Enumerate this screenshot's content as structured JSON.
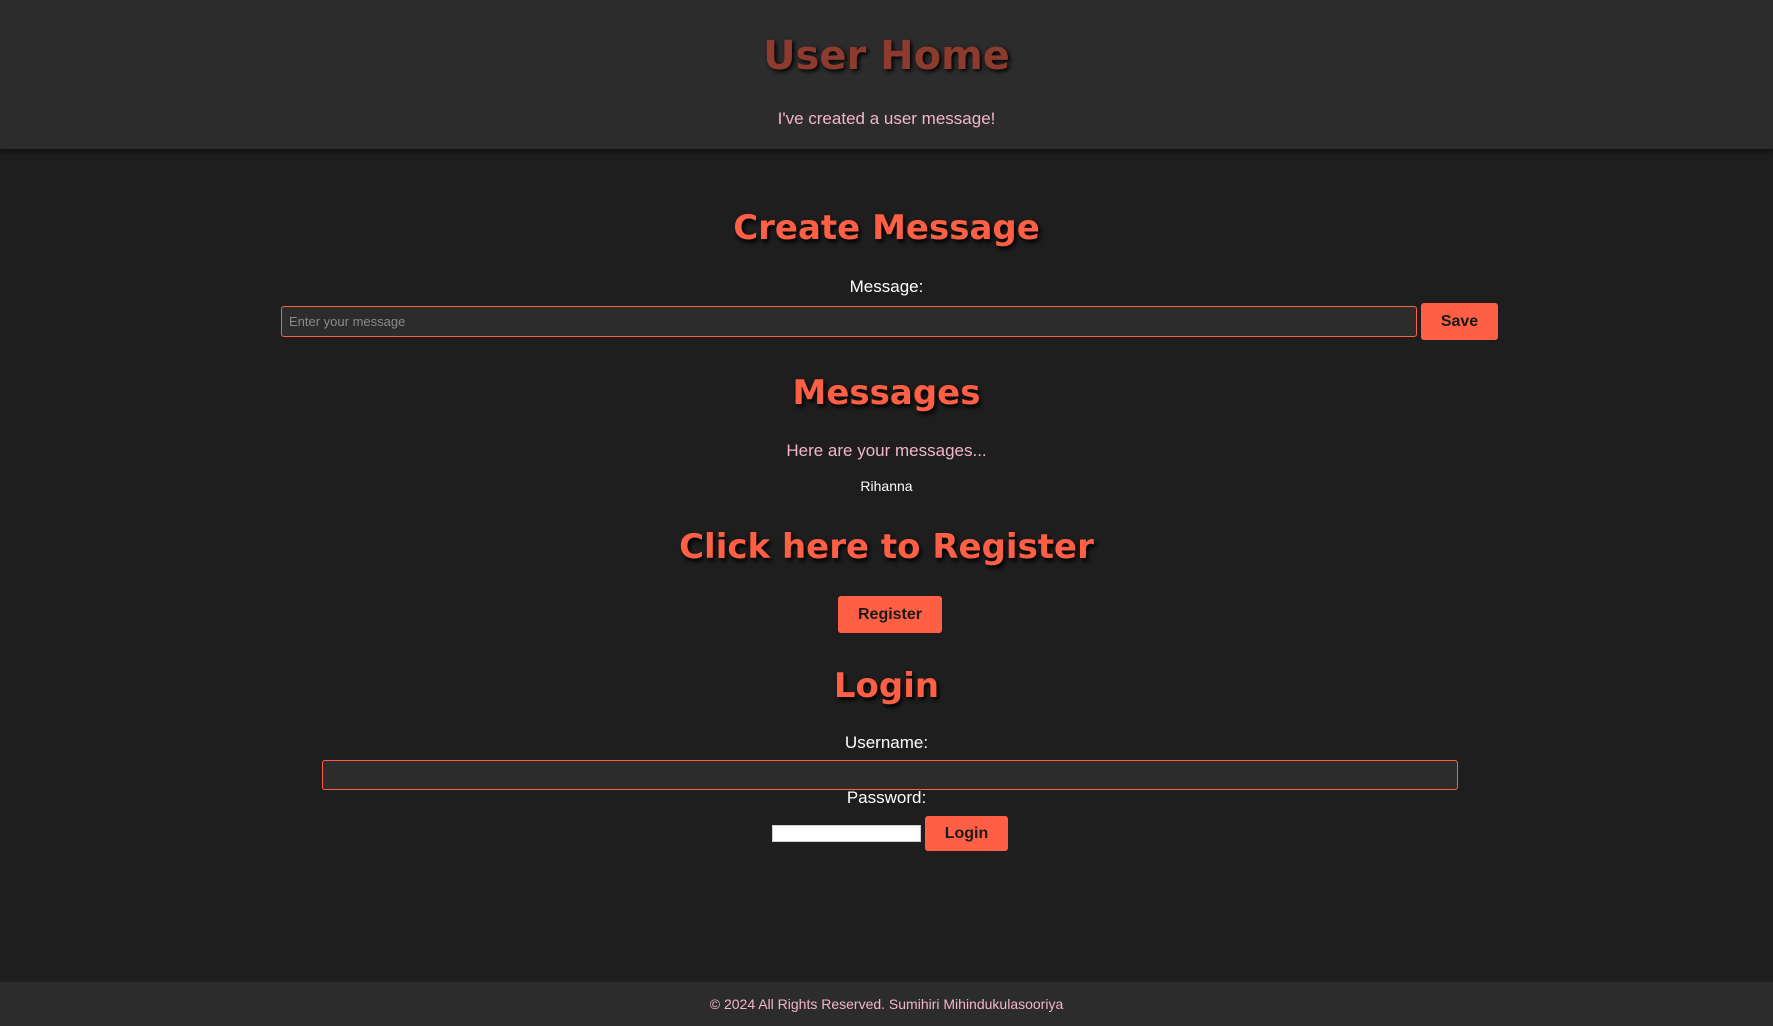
{
  "header": {
    "title": "User Home",
    "subtitle": "I've created a user message!"
  },
  "create_message": {
    "title": "Create Message",
    "message_label": "Message:",
    "message_placeholder": "Enter your message",
    "message_value": "",
    "save_label": "Save"
  },
  "messages": {
    "title": "Messages",
    "intro": "Here are your messages...",
    "items": [
      "Rihanna"
    ]
  },
  "register": {
    "title": "Click here to Register",
    "button_label": "Register"
  },
  "login": {
    "title": "Login",
    "username_label": "Username:",
    "username_value": "",
    "password_label": "Password:",
    "password_value": "",
    "button_label": "Login"
  },
  "footer": {
    "text": "© 2024 All Rights Reserved. Sumihiri Mihindukulasooriya"
  },
  "colors": {
    "accent": "#ff5f45",
    "header_title": "#8c3b2e",
    "pink_text": "#f3b6c8",
    "background": "#1e1e1e",
    "panel": "#2c2c2c"
  }
}
